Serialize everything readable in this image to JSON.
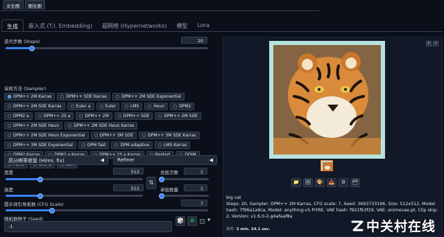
{
  "top_tabs": [
    "文生图",
    "图生图"
  ],
  "main_tabs": [
    "生成",
    "嵌入式 (T.I. Embedding)",
    "超网络 (Hypernetworks)",
    "模型",
    "Lora"
  ],
  "steps": {
    "label": "迭代步数 (Steps)",
    "value": "20",
    "fraction": 0.13
  },
  "sampler": {
    "label": "采样方法 (Sampler)",
    "options": [
      "DPM++ 2M Karras",
      "DPM++ SDE Karras",
      "DPM++ 2M SDE Exponential",
      "DPM++ 2M SDE Karras",
      "Euler a",
      "Euler",
      "LMS",
      "Heun",
      "DPM2",
      "DPM2 a",
      "DPM++ 2S a",
      "DPM++ 2M",
      "DPM++ SDE",
      "DPM++ 2M SDE",
      "DPM++ 2M SDE Heun",
      "DPM++ 2M SDE Heun Karras",
      "DPM++ 2M SDE Heun Exponential",
      "DPM++ 3M SDE",
      "DPM++ 3M SDE Karras",
      "DPM++ 3M SDE Exponential",
      "DPM fast",
      "DPM adaptive",
      "LMS Karras",
      "DPM2 Karras",
      "DPM2 a Karras",
      "DPM++ 2S a Karras",
      "Restart",
      "DDIM",
      "PLMS",
      "UniPC",
      "LCM"
    ],
    "selected": "DPM++ 2M Karras"
  },
  "hires": {
    "label": "高分辨率修复 (Hires. fix)",
    "arrow": "◀"
  },
  "refiner": {
    "label": "Refiner",
    "arrow": "◀"
  },
  "width": {
    "label": "宽度",
    "value": "512",
    "fraction": 0.25
  },
  "height": {
    "label": "高度",
    "value": "512",
    "fraction": 0.25
  },
  "batch_count": {
    "label": "总批次数",
    "value": "1",
    "fraction": 0.0
  },
  "batch_size": {
    "label": "单批数量",
    "value": "1",
    "fraction": 0.0
  },
  "swap_icon": "⇅",
  "cfg": {
    "label": "提示词引导系数 (CFG Scale)",
    "value": "7",
    "fraction": 0.23
  },
  "seed": {
    "label": "随机数种子 (Seed)",
    "value": "-1",
    "dice_icon": "🎲",
    "recycle_icon": "♻",
    "extra_arrow": "▼"
  },
  "corner_buttons": [
    "A",
    "×"
  ],
  "tools": [
    "📁",
    "🖼",
    "🎨",
    "📤",
    "⚙",
    "🗂"
  ],
  "caption": {
    "prompt": "big cat",
    "params": "Steps: 20, Sampler: DPM++ 2M Karras, CFG scale: 7, Seed: 3693733196, Size: 512x512, Model hash: 7f96a1a9ca, Model: anything-v5-PrtRE, VAE hash: f921fb3f29, VAE: animevae.pt, Clip skip: 2, Version: v1.6.0-2-g4afaaf8a"
  },
  "time": {
    "prefix": "用时:",
    "value": "3 min. 24.1 sec."
  },
  "watermark": "中关村在线",
  "colors": {
    "accent": "#3b82f6",
    "background": "#0b0f19",
    "panel": "#111827",
    "thumb_border": "#f97316"
  }
}
